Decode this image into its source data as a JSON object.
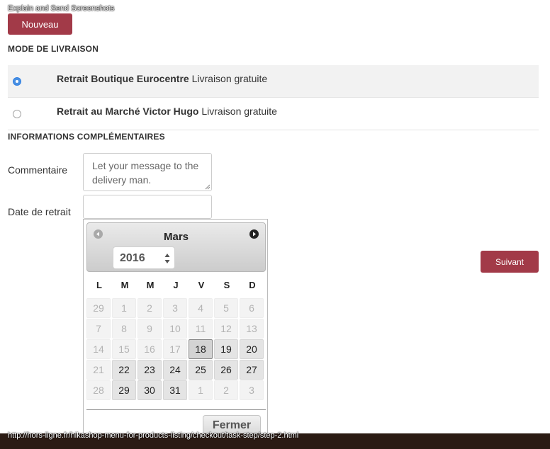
{
  "extension_label": "Explain and Send Screenshots",
  "new_button": "Nouveau",
  "shipping": {
    "title": "MODE DE LIVRAISON",
    "options": [
      {
        "name": "Retrait Boutique Eurocentre",
        "price": "Livraison gratuite",
        "selected": true
      },
      {
        "name": "Retrait au Marché Victor Hugo",
        "price": "Livraison gratuite",
        "selected": false
      }
    ]
  },
  "additional": {
    "title": "INFORMATIONS COMPLÉMENTAIRES",
    "comment_label": "Commentaire",
    "comment_placeholder": "Let your message to the delivery man.",
    "date_label": "Date de retrait",
    "date_value": ""
  },
  "next_button": "Suivant",
  "datepicker": {
    "month": "Mars",
    "year": "2016",
    "weekdays": [
      "L",
      "M",
      "M",
      "J",
      "V",
      "S",
      "D"
    ],
    "weeks": [
      [
        {
          "d": "29",
          "s": "disabled"
        },
        {
          "d": "1",
          "s": "disabled"
        },
        {
          "d": "2",
          "s": "disabled"
        },
        {
          "d": "3",
          "s": "disabled"
        },
        {
          "d": "4",
          "s": "disabled"
        },
        {
          "d": "5",
          "s": "disabled"
        },
        {
          "d": "6",
          "s": "disabled"
        }
      ],
      [
        {
          "d": "7",
          "s": "disabled"
        },
        {
          "d": "8",
          "s": "disabled"
        },
        {
          "d": "9",
          "s": "disabled"
        },
        {
          "d": "10",
          "s": "disabled"
        },
        {
          "d": "11",
          "s": "disabled"
        },
        {
          "d": "12",
          "s": "disabled"
        },
        {
          "d": "13",
          "s": "disabled"
        }
      ],
      [
        {
          "d": "14",
          "s": "disabled"
        },
        {
          "d": "15",
          "s": "disabled"
        },
        {
          "d": "16",
          "s": "disabled"
        },
        {
          "d": "17",
          "s": "disabled"
        },
        {
          "d": "18",
          "s": "today"
        },
        {
          "d": "19",
          "s": "enabled"
        },
        {
          "d": "20",
          "s": "enabled"
        }
      ],
      [
        {
          "d": "21",
          "s": "disabled"
        },
        {
          "d": "22",
          "s": "enabled"
        },
        {
          "d": "23",
          "s": "enabled"
        },
        {
          "d": "24",
          "s": "enabled"
        },
        {
          "d": "25",
          "s": "enabled"
        },
        {
          "d": "26",
          "s": "enabled"
        },
        {
          "d": "27",
          "s": "enabled"
        }
      ],
      [
        {
          "d": "28",
          "s": "disabled"
        },
        {
          "d": "29",
          "s": "enabled"
        },
        {
          "d": "30",
          "s": "enabled"
        },
        {
          "d": "31",
          "s": "enabled"
        },
        {
          "d": "1",
          "s": "disabled"
        },
        {
          "d": "2",
          "s": "disabled"
        },
        {
          "d": "3",
          "s": "disabled"
        }
      ]
    ],
    "close_label": "Fermer"
  },
  "status_url": "http://hors-ligne.fr/hikashop-menu-for-products-listing/checkout/task-step/step-2.html",
  "colors": {
    "brand_red": "#a23a48",
    "radio_blue": "#4a90e2"
  }
}
